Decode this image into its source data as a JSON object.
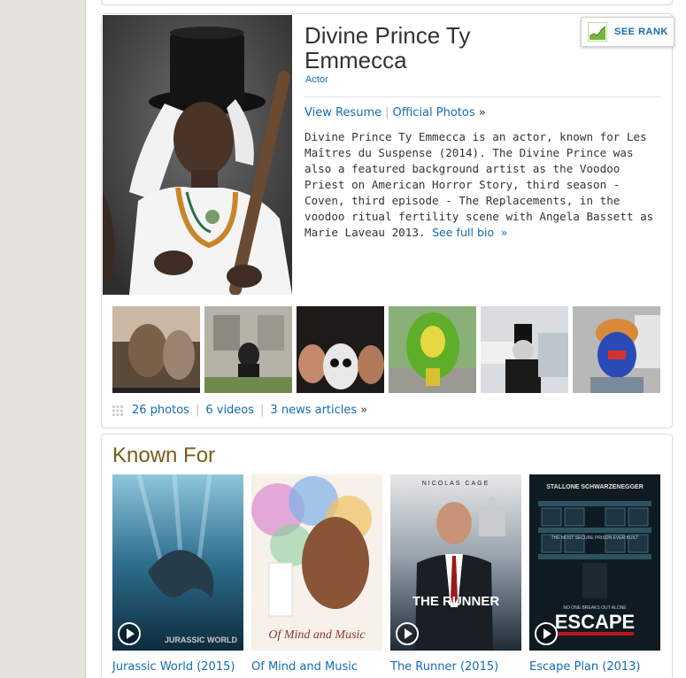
{
  "person": {
    "name": "Divine Prince Ty Emmecca",
    "role": "Actor"
  },
  "rank_button": {
    "label": "SEE RANK",
    "icon": "chart-icon"
  },
  "overview_links": {
    "resume": "View Resume",
    "photos": "Official Photos",
    "more": "»"
  },
  "bio": {
    "text": "Divine Prince Ty Emmecca is an actor, known for Les Maîtres du Suspense (2014). The Divine Prince was also a featured background artist as the Voodoo Priest on American Horror Story, third season - Coven, third episode - The Replacements, in the voodoo ritual fertility scene with Angela Bassett as Marie Laveau 2013. ",
    "see_full_bio": "See full bio",
    "more": "»"
  },
  "media": {
    "photos": "26 photos",
    "videos": "6 videos",
    "news": "3 news articles",
    "more": "»"
  },
  "known_for": {
    "title": "Known For",
    "items": [
      {
        "title": "Jurassic World (2015)",
        "poster_text": "JURASSIC WORLD"
      },
      {
        "title": "Of Mind and Music",
        "poster_text": "Of Mind and Music"
      },
      {
        "title": "The Runner (2015)",
        "poster_text": "THE RUNNER",
        "poster_top": "NICOLAS CAGE"
      },
      {
        "title": "Escape Plan (2013)",
        "poster_text": "ESCAPE",
        "poster_top": "STALLONE  SCHWARZENEGGER",
        "tagline": "THE MOST SECURE PRISON EVER BUILT",
        "tagline2": "NO ONE BREAKS OUT ALONE"
      }
    ]
  },
  "colors": {
    "link": "#136cb2",
    "heading_gold": "#7a5c1a",
    "page_bg": "#e3e2dd"
  }
}
